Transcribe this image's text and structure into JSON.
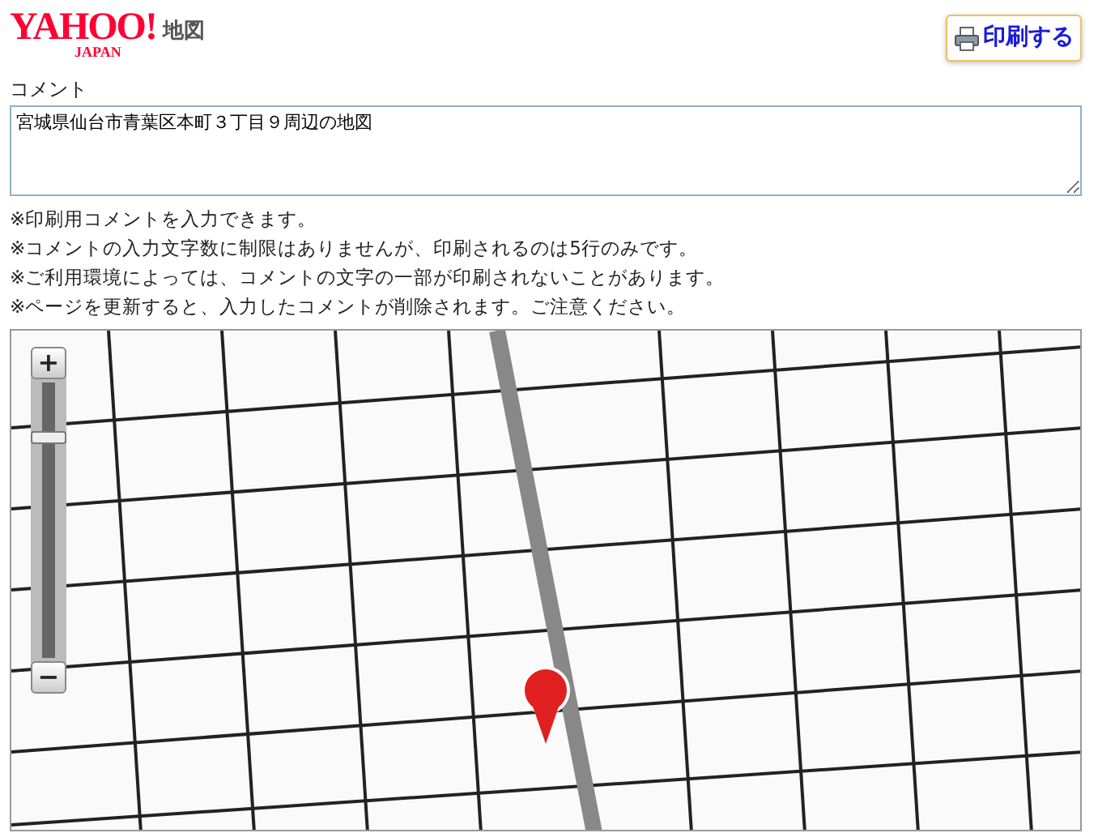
{
  "header": {
    "logo": "YAHOO!",
    "logo_sub": "JAPAN",
    "service": "地図",
    "print_button": "印刷する"
  },
  "comment": {
    "label": "コメント",
    "value": "宮城県仙台市青葉区本町３丁目９周辺の地図"
  },
  "notes": [
    "※印刷用コメントを入力できます。",
    "※コメントの入力文字数に制限はありませんが、印刷されるのは5行のみです。",
    "※ご利用環境によっては、コメントの文字の一部が印刷されないことがあります。",
    "※ページを更新すると、入力したコメントが削除されます。ご注意ください。"
  ],
  "map": {
    "zoom_in": "+",
    "zoom_out": "−",
    "zoom": {
      "level": 0.8
    }
  }
}
